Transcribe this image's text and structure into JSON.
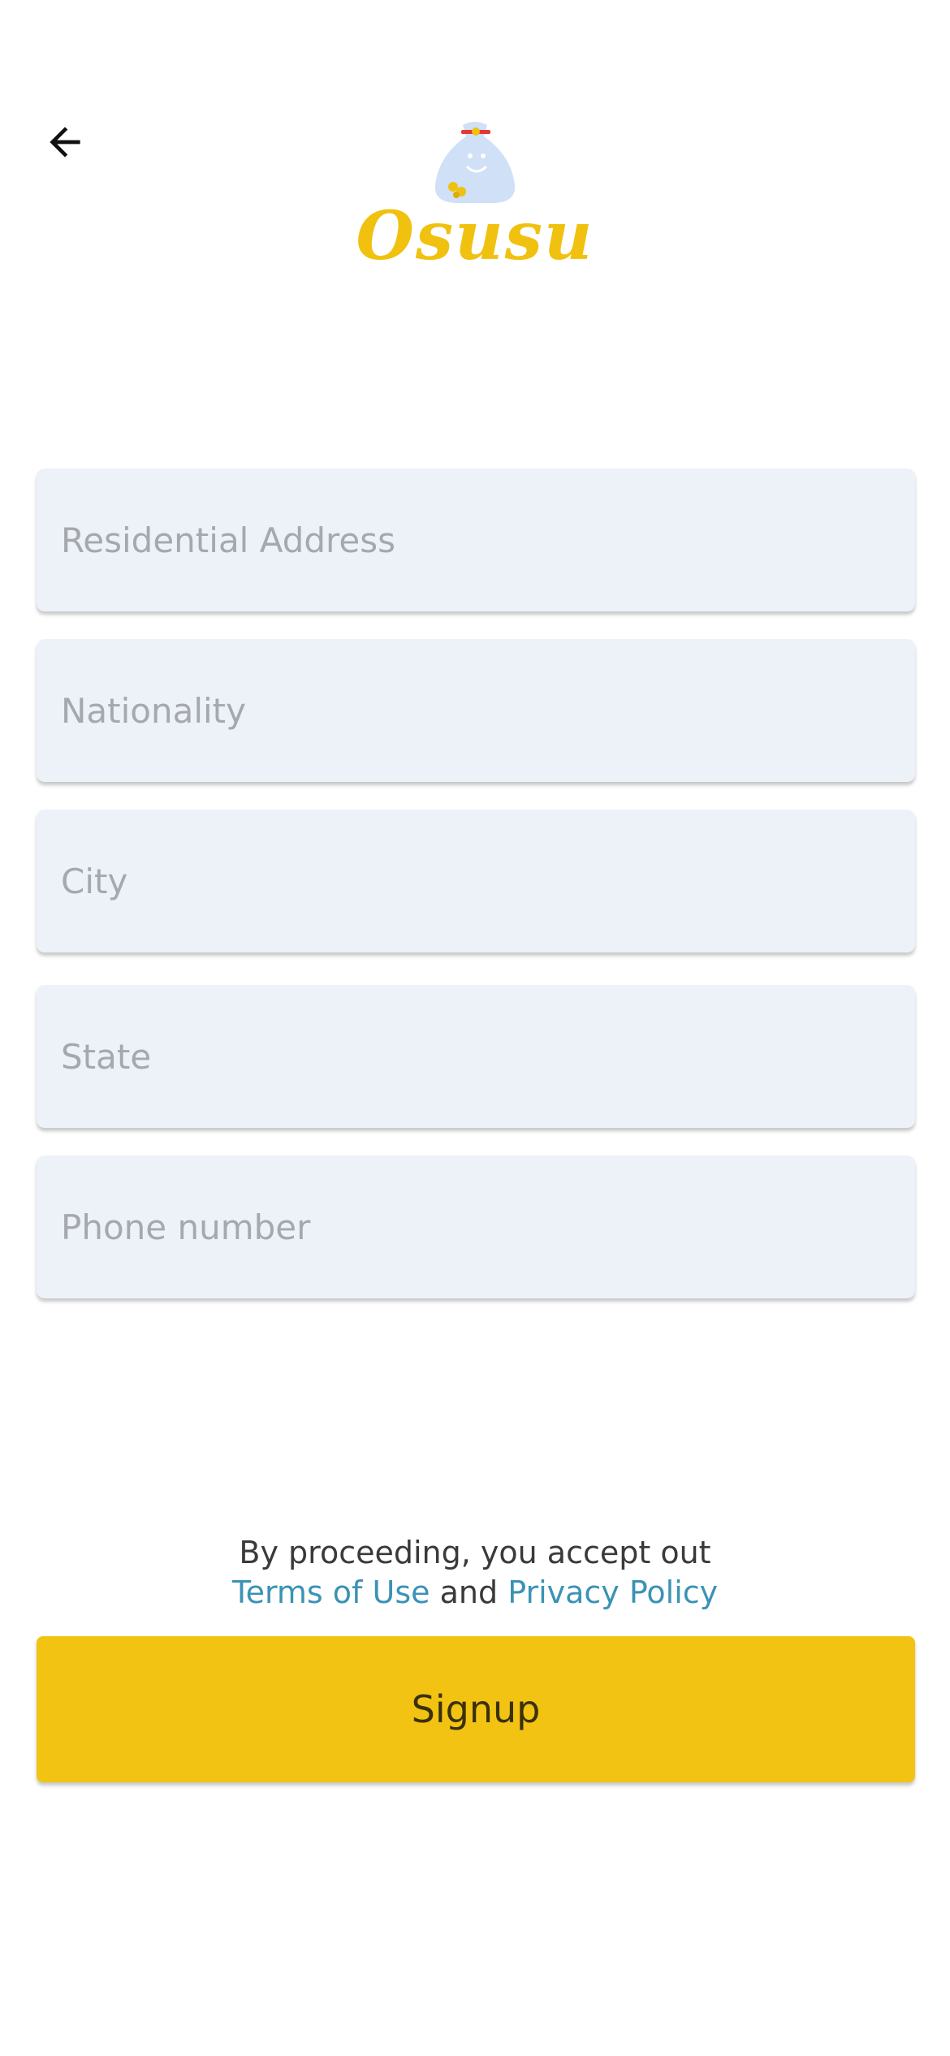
{
  "header": {
    "back_icon": "arrow-left-icon",
    "logo_text": "Osusu",
    "logo_icon": "money-bag-icon"
  },
  "form": {
    "fields": [
      {
        "placeholder": "Residential Address",
        "value": ""
      },
      {
        "placeholder": "Nationality",
        "value": ""
      },
      {
        "placeholder": "City",
        "value": ""
      },
      {
        "placeholder": "State",
        "value": ""
      },
      {
        "placeholder": "Phone number",
        "value": ""
      }
    ]
  },
  "legal": {
    "prefix": "By proceeding, you accept out",
    "terms_link": "Terms of Use",
    "conjunction": "and",
    "privacy_link": "Privacy Policy"
  },
  "signup": {
    "label": "Signup"
  },
  "colors": {
    "brand_yellow": "#f3c313",
    "logo_yellow": "#f0c10f",
    "link_blue": "#3b93b5",
    "field_background": "#edf2f9",
    "bag_blue": "#cfe0f7",
    "bag_tie_red": "#e53935"
  }
}
